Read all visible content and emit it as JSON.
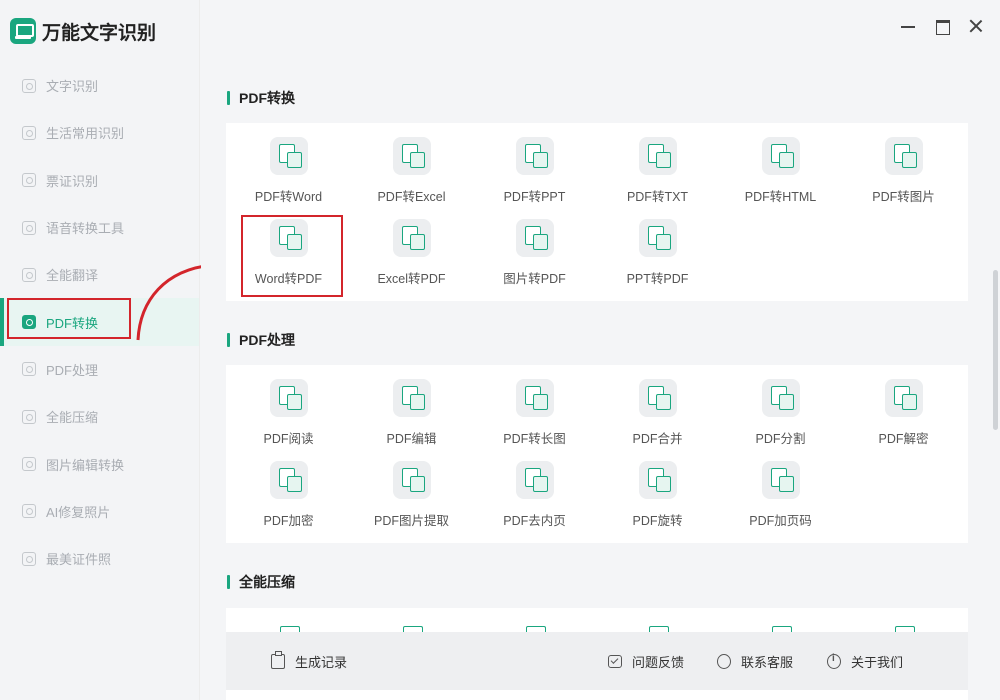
{
  "app": {
    "title": "万能文字识别"
  },
  "colors": {
    "accent": "#1aa67f",
    "highlight": "#d3252b",
    "sidebar_bg": "#f3f4f6"
  },
  "sidebar": {
    "items": [
      {
        "label": "文字识别",
        "icon": "scan-text-icon",
        "active": false
      },
      {
        "label": "生活常用识别",
        "icon": "scan-life-icon",
        "active": false
      },
      {
        "label": "票证识别",
        "icon": "scan-ticket-icon",
        "active": false
      },
      {
        "label": "语音转换工具",
        "icon": "voice-icon",
        "active": false
      },
      {
        "label": "全能翻译",
        "icon": "translate-icon",
        "active": false
      },
      {
        "label": "PDF转换",
        "icon": "pdf-convert-icon",
        "active": true
      },
      {
        "label": "PDF处理",
        "icon": "pdf-process-icon",
        "active": false
      },
      {
        "label": "全能压缩",
        "icon": "compress-icon",
        "active": false
      },
      {
        "label": "图片编辑转换",
        "icon": "image-edit-icon",
        "active": false
      },
      {
        "label": "AI修复照片",
        "icon": "ai-repair-icon",
        "active": false
      },
      {
        "label": "最美证件照",
        "icon": "id-photo-icon",
        "active": false
      }
    ]
  },
  "window_controls": {
    "minimize": "minimize-icon",
    "maximize": "maximize-icon",
    "close": "close-icon"
  },
  "sections": [
    {
      "title": "PDF转换",
      "tools": [
        {
          "label": "PDF转Word",
          "icon": "pdf-to-word-icon"
        },
        {
          "label": "PDF转Excel",
          "icon": "pdf-to-excel-icon"
        },
        {
          "label": "PDF转PPT",
          "icon": "pdf-to-ppt-icon"
        },
        {
          "label": "PDF转TXT",
          "icon": "pdf-to-txt-icon"
        },
        {
          "label": "PDF转HTML",
          "icon": "pdf-to-html-icon"
        },
        {
          "label": "PDF转图片",
          "icon": "pdf-to-image-icon"
        },
        {
          "label": "Word转PDF",
          "icon": "word-to-pdf-icon"
        },
        {
          "label": "Excel转PDF",
          "icon": "excel-to-pdf-icon"
        },
        {
          "label": "图片转PDF",
          "icon": "image-to-pdf-icon"
        },
        {
          "label": "PPT转PDF",
          "icon": "ppt-to-pdf-icon"
        }
      ]
    },
    {
      "title": "PDF处理",
      "tools": [
        {
          "label": "PDF阅读",
          "icon": "pdf-read-icon"
        },
        {
          "label": "PDF编辑",
          "icon": "pdf-edit-icon"
        },
        {
          "label": "PDF转长图",
          "icon": "pdf-long-image-icon"
        },
        {
          "label": "PDF合并",
          "icon": "pdf-merge-icon"
        },
        {
          "label": "PDF分割",
          "icon": "pdf-split-icon"
        },
        {
          "label": "PDF解密",
          "icon": "pdf-decrypt-icon"
        },
        {
          "label": "PDF加密",
          "icon": "pdf-encrypt-icon"
        },
        {
          "label": "PDF图片提取",
          "icon": "pdf-extract-image-icon"
        },
        {
          "label": "PDF去内页",
          "icon": "pdf-remove-page-icon"
        },
        {
          "label": "PDF旋转",
          "icon": "pdf-rotate-icon"
        },
        {
          "label": "PDF加页码",
          "icon": "pdf-page-number-icon"
        }
      ]
    },
    {
      "title": "全能压缩",
      "tools": []
    }
  ],
  "bottom_bar": {
    "history": "生成记录",
    "feedback": "问题反馈",
    "service": "联系客服",
    "about": "关于我们"
  }
}
